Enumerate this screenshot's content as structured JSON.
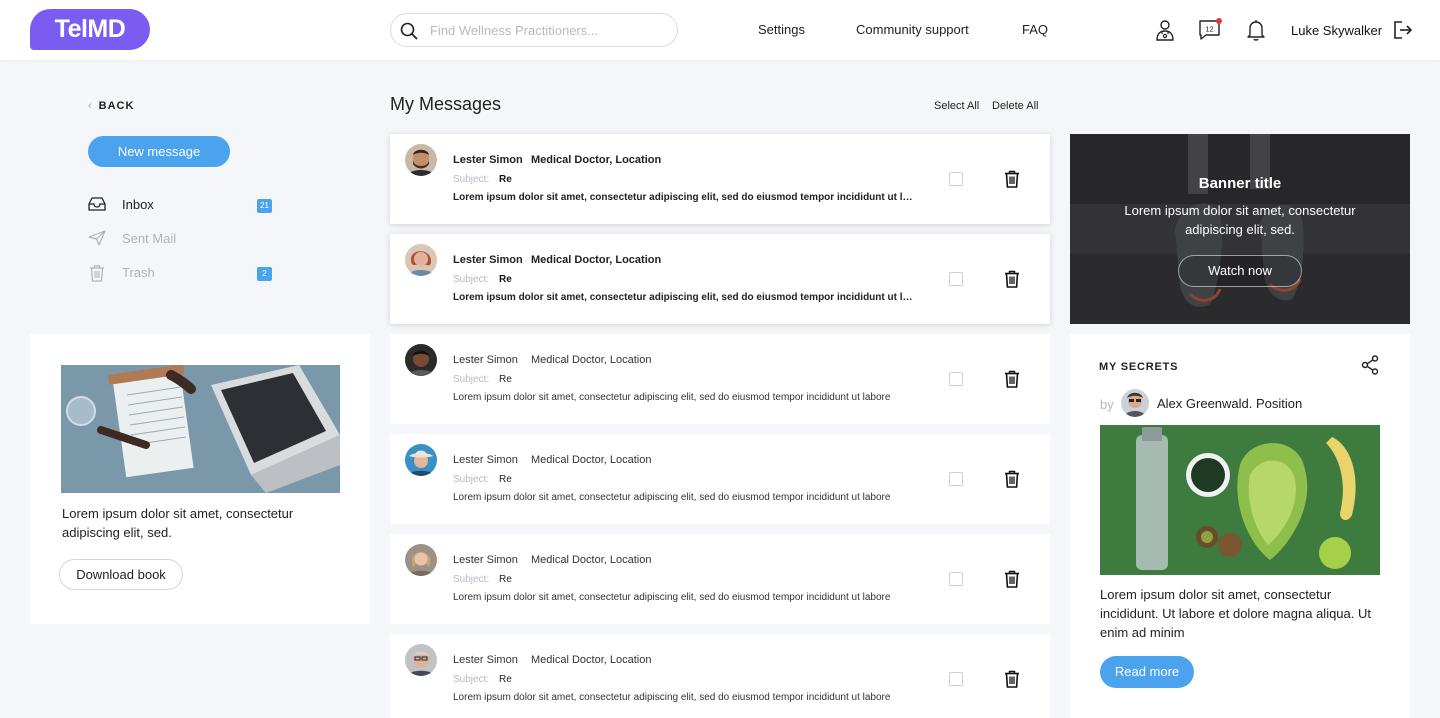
{
  "header": {
    "logo": "TelMD",
    "search_placeholder": "Find Wellness Practitioners...",
    "nav": [
      "Settings",
      "Community support",
      "FAQ"
    ],
    "notification_count": "12",
    "user_name": "Luke Skywalker"
  },
  "sidebar": {
    "back_label": "BACK",
    "new_message_label": "New message",
    "folders": [
      {
        "label": "Inbox",
        "badge": "21",
        "icon": "inbox-icon"
      },
      {
        "label": "Sent Mail",
        "badge": "",
        "icon": "send-icon"
      },
      {
        "label": "Trash",
        "badge": "2",
        "icon": "trash-icon"
      }
    ],
    "book_card": {
      "text": "Lorem ipsum dolor sit amet, consectetur adipiscing elit, sed.",
      "button": "Download book"
    }
  },
  "messages": {
    "title": "My Messages",
    "select_all": "Select All",
    "delete_all": "Delete All",
    "subject_label": "Subject:",
    "items": [
      {
        "sender": "Lester Simon",
        "role": "Medical Doctor, Location",
        "subject": "Re",
        "body": "Lorem ipsum dolor sit amet, consectetur adipiscing elit, sed do eiusmod tempor incididunt ut labore",
        "unread": true
      },
      {
        "sender": "Lester Simon",
        "role": "Medical Doctor, Location",
        "subject": "Re",
        "body": "Lorem ipsum dolor sit amet, consectetur adipiscing elit, sed do eiusmod tempor incididunt ut labore",
        "unread": true
      },
      {
        "sender": "Lester Simon",
        "role": "Medical Doctor, Location",
        "subject": "Re",
        "body": "Lorem ipsum dolor sit amet, consectetur adipiscing elit, sed do eiusmod tempor incididunt ut labore",
        "unread": false
      },
      {
        "sender": "Lester Simon",
        "role": "Medical Doctor, Location",
        "subject": "Re",
        "body": "Lorem ipsum dolor sit amet, consectetur adipiscing elit, sed do eiusmod tempor incididunt ut labore",
        "unread": false
      },
      {
        "sender": "Lester Simon",
        "role": "Medical Doctor, Location",
        "subject": "Re",
        "body": "Lorem ipsum dolor sit amet, consectetur adipiscing elit, sed do eiusmod tempor incididunt ut labore",
        "unread": false
      },
      {
        "sender": "Lester Simon",
        "role": "Medical Doctor, Location",
        "subject": "Re",
        "body": "Lorem ipsum dolor sit amet, consectetur adipiscing elit, sed do eiusmod tempor incididunt ut labore",
        "unread": false
      }
    ]
  },
  "banner": {
    "title": "Banner title",
    "text": "Lorem ipsum dolor sit amet, consectetur adipiscing elit, sed.",
    "button": "Watch now"
  },
  "secrets": {
    "title": "MY SECRETS",
    "by": "by",
    "author": "Alex Greenwald. Position",
    "text": "Lorem ipsum dolor sit amet, consectetur incididunt. Ut labore et dolore magna aliqua. Ut enim ad minim",
    "button": "Read more"
  },
  "colors": {
    "accent": "#4aa3ec",
    "brand": "#7b5cf0",
    "background": "#f5f6f9"
  }
}
